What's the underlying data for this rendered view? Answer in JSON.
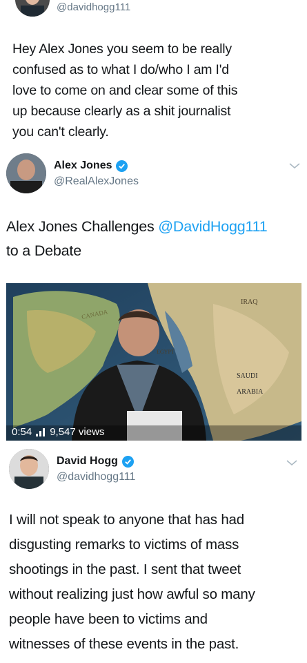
{
  "tweet1": {
    "handle": "@davidhogg111",
    "lines": [
      "Hey Alex Jones you seem to be really",
      "confused as to what I do/who I am I'd",
      "love to come on and clear some of this",
      "up because clearly as a shit journalist",
      "you can't clearly."
    ]
  },
  "tweet2": {
    "name": "Alex Jones",
    "handle": "@RealAlexJones",
    "text_prefix": "Alex Jones Challenges ",
    "mention": "@DavidHogg111",
    "text_line2": "to a Debate",
    "video": {
      "duration": "0:54",
      "views": "9,547 views",
      "map_labels": [
        "IRAQ",
        "SAUDI",
        "ARABIA",
        "EGYPT",
        "CANADA"
      ]
    }
  },
  "tweet3": {
    "name": "David Hogg",
    "handle": "@davidhogg111",
    "lines": [
      "I will not speak to anyone that has had",
      "disgusting remarks to victims of mass",
      "shootings in the past. I sent that tweet",
      "without realizing just how awful so many",
      "people have been to victims and",
      "witnesses of these events in the past."
    ]
  },
  "colors": {
    "accent": "#1da1f2",
    "handle": "#657786"
  }
}
